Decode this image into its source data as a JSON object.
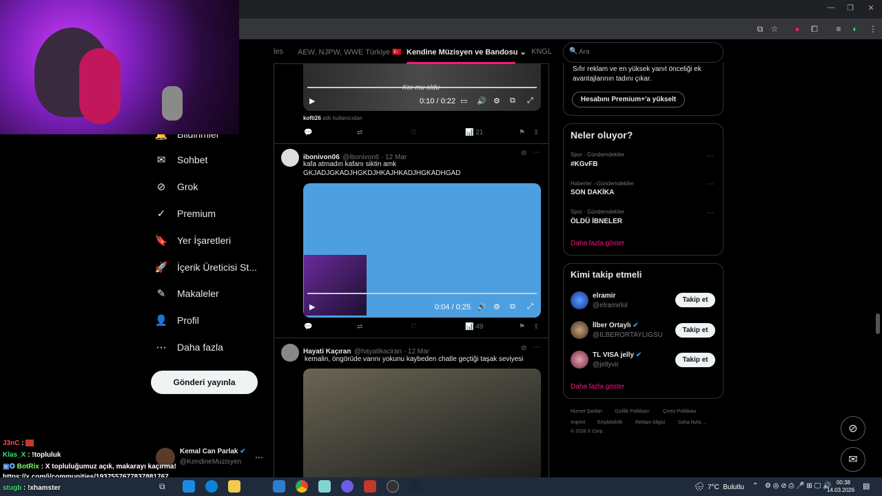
{
  "timeline_tabs": [
    "les",
    "AEW, NJPW, WWE Türkiye 🇹🇷",
    "Kendine Müzisyen ve Bandosu",
    "KNGL"
  ],
  "nav": [
    {
      "label": "Bildirimler"
    },
    {
      "label": "Sohbet"
    },
    {
      "label": "Grok"
    },
    {
      "label": "Premium"
    },
    {
      "label": "Yer İşaretleri"
    },
    {
      "label": "İçerik Üreticisi St..."
    },
    {
      "label": "Makaleler"
    },
    {
      "label": "Profil"
    },
    {
      "label": "Daha fazla"
    }
  ],
  "post_button": "Gönderi yayınla",
  "account": {
    "name": "Kemal Can Parlak",
    "handle": "@KendineMuzisyen"
  },
  "tweet1": {
    "subtitle": "Kor mu oldu",
    "time": "0:10 / 0:22",
    "by_user": "kofti26",
    "by_suffix": "adlı kullanıcıdan",
    "views": "21"
  },
  "tweet2": {
    "name": "ibonivon06",
    "handle": "@ibonivon6 · 12 Mar",
    "text_line1": "kafa atmadın kafanı siktin amk",
    "text_line2": "GKJADJGKADJHGKDJHKAJHKADJHGKADHGAD",
    "time": "0:04 / 0:25",
    "views": "49"
  },
  "tweet3": {
    "name": "Hayati Kaçıran",
    "handle": "@hayatikaciran · 12 Mar",
    "text": "kemalin, öngörüde varını yokunu kaybeden chatle geçtiği taşak seviyesi"
  },
  "search_placeholder": "Ara",
  "premium": {
    "text_line1": "Sıfır reklam ve en yüksek yanıt önceliği ek",
    "text_line2": "avantajlarının tadını çıkar.",
    "button": "Hesabını Premium+'a yükselt"
  },
  "trends": {
    "title": "Neler oluyor?",
    "items": [
      {
        "meta": "Spor · Gündemdekiler",
        "name": "#KGvFB"
      },
      {
        "meta": "Haberler · Gündemdekiler",
        "name": "SON DAKİKA"
      },
      {
        "meta": "Spor · Gündemdekiler",
        "name": "ÖLDÜ İBNELER"
      }
    ],
    "show_more": "Daha fazla göster"
  },
  "who_to_follow": {
    "title": "Kimi takip etmeli",
    "items": [
      {
        "name": "elramir",
        "handle": "@elramirlol",
        "button": "Takip et"
      },
      {
        "name": "İlber Ortaylı",
        "handle": "@ILBERORTAYLIGSU",
        "button": "Takip et"
      },
      {
        "name": "TL VISA jelly",
        "handle": "@jellyvir",
        "button": "Takip et"
      }
    ],
    "show_more": "Daha fazla göster"
  },
  "footer": {
    "row1": [
      "Hizmet Şartları",
      "Gizlilik Politikası",
      "Çerez Politikası"
    ],
    "row2": [
      "Imprint",
      "Erişilebilirlik",
      "Reklam bilgisi",
      "Daha fazla ..."
    ],
    "copyright": "© 2026 X Corp."
  },
  "chat": [
    {
      "user": "J3nC",
      "text": ":",
      "color": "#ff4d4d"
    },
    {
      "user": "Klas_X",
      "text": ": !topluluk",
      "color": "#3ae374"
    },
    {
      "user": "BotRix",
      "text": ": X topluluğumuz açık, makarayı kaçırma!",
      "color": "#7cff6b"
    },
    {
      "user": "",
      "text": "https://x.com/i/communities/1937557677837881767",
      "color": "#ffffff"
    },
    {
      "user": "stugb",
      "text": ": !xhamster",
      "color": "#3ae374"
    }
  ],
  "taskbar": {
    "weather": "7°C  Bulutlu",
    "time": "00:38",
    "date": "14.03.2026"
  }
}
